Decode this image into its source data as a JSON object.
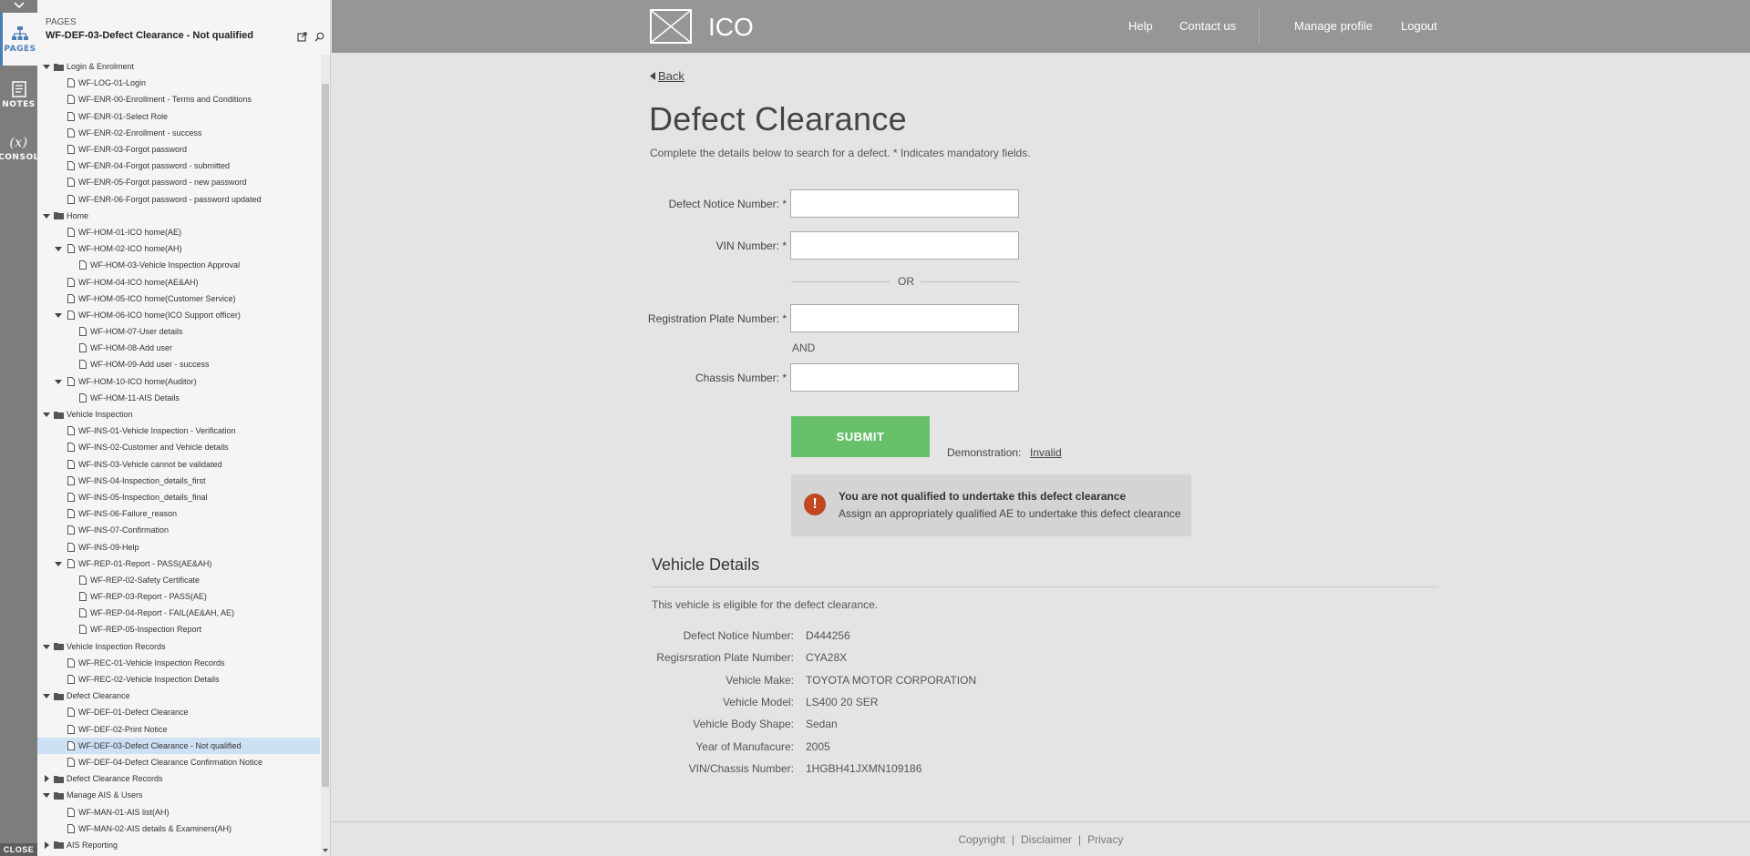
{
  "rail": {
    "pages_label": "PAGES",
    "notes_label": "NOTES",
    "console_label": "CONSOL",
    "console_symbol": "(x)",
    "close_label": "CLOSE"
  },
  "panel": {
    "caption": "PAGES",
    "current_page": "WF-DEF-03-Defect Clearance - Not qualified",
    "tree": [
      {
        "label": "Login & Enrolment",
        "type": "folder",
        "level": 0,
        "expanded": true
      },
      {
        "label": "WF-LOG-01-Login",
        "type": "page",
        "level": 1
      },
      {
        "label": "WF-ENR-00-Enrollment - Terms and Conditions",
        "type": "page",
        "level": 1
      },
      {
        "label": "WF-ENR-01-Select Role",
        "type": "page",
        "level": 1
      },
      {
        "label": "WF-ENR-02-Enrollment - success",
        "type": "page",
        "level": 1
      },
      {
        "label": "WF-ENR-03-Forgot password",
        "type": "page",
        "level": 1
      },
      {
        "label": "WF-ENR-04-Forgot password - submitted",
        "type": "page",
        "level": 1
      },
      {
        "label": "WF-ENR-05-Forgot password - new password",
        "type": "page",
        "level": 1
      },
      {
        "label": "WF-ENR-06-Forgot password - password updated",
        "type": "page",
        "level": 1
      },
      {
        "label": "Home",
        "type": "folder",
        "level": 0,
        "expanded": true
      },
      {
        "label": "WF-HOM-01-ICO home(AE)",
        "type": "page",
        "level": 1
      },
      {
        "label": "WF-HOM-02-ICO home(AH)",
        "type": "page",
        "level": 1,
        "expanded": true
      },
      {
        "label": "WF-HOM-03-Vehicle Inspection Approval",
        "type": "page",
        "level": 2
      },
      {
        "label": "WF-HOM-04-ICO home(AE&AH)",
        "type": "page",
        "level": 1
      },
      {
        "label": "WF-HOM-05-ICO home(Customer Service)",
        "type": "page",
        "level": 1
      },
      {
        "label": "WF-HOM-06-ICO home(ICO Support officer)",
        "type": "page",
        "level": 1,
        "expanded": true
      },
      {
        "label": "WF-HOM-07-User details",
        "type": "page",
        "level": 2
      },
      {
        "label": "WF-HOM-08-Add user",
        "type": "page",
        "level": 2
      },
      {
        "label": "WF-HOM-09-Add user - success",
        "type": "page",
        "level": 2
      },
      {
        "label": "WF-HOM-10-ICO home(Auditor)",
        "type": "page",
        "level": 1,
        "expanded": true
      },
      {
        "label": "WF-HOM-11-AIS Details",
        "type": "page",
        "level": 2
      },
      {
        "label": "Vehicle Inspection",
        "type": "folder",
        "level": 0,
        "expanded": true
      },
      {
        "label": "WF-INS-01-Vehicle Inspection - Verification",
        "type": "page",
        "level": 1
      },
      {
        "label": "WF-INS-02-Customer and Vehicle details",
        "type": "page",
        "level": 1
      },
      {
        "label": "WF-INS-03-Vehicle cannot be validated",
        "type": "page",
        "level": 1
      },
      {
        "label": "WF-INS-04-Inspection_details_first",
        "type": "page",
        "level": 1
      },
      {
        "label": "WF-INS-05-Inspection_details_final",
        "type": "page",
        "level": 1
      },
      {
        "label": "WF-INS-06-Failure_reason",
        "type": "page",
        "level": 1
      },
      {
        "label": "WF-INS-07-Confirmation",
        "type": "page",
        "level": 1
      },
      {
        "label": "WF-INS-09-Help",
        "type": "page",
        "level": 1
      },
      {
        "label": "WF-REP-01-Report - PASS(AE&AH)",
        "type": "page",
        "level": 1,
        "expanded": true
      },
      {
        "label": "WF-REP-02-Safety Certificate",
        "type": "page",
        "level": 2
      },
      {
        "label": "WF-REP-03-Report - PASS(AE)",
        "type": "page",
        "level": 2
      },
      {
        "label": "WF-REP-04-Report - FAIL(AE&AH, AE)",
        "type": "page",
        "level": 2
      },
      {
        "label": "WF-REP-05-Inspection Report",
        "type": "page",
        "level": 2
      },
      {
        "label": "Vehicle Inspection Records",
        "type": "folder",
        "level": 0,
        "expanded": true
      },
      {
        "label": "WF-REC-01-Vehicle Inspection Records",
        "type": "page",
        "level": 1
      },
      {
        "label": "WF-REC-02-Vehicle Inspection Details",
        "type": "page",
        "level": 1
      },
      {
        "label": "Defect Clearance",
        "type": "folder",
        "level": 0,
        "expanded": true
      },
      {
        "label": "WF-DEF-01-Defect Clearance",
        "type": "page",
        "level": 1
      },
      {
        "label": "WF-DEF-02-Print Notice",
        "type": "page",
        "level": 1
      },
      {
        "label": "WF-DEF-03-Defect Clearance - Not qualified",
        "type": "page",
        "level": 1,
        "selected": true
      },
      {
        "label": "WF-DEF-04-Defect Clearance Confirmation Notice",
        "type": "page",
        "level": 1
      },
      {
        "label": "Defect Clearance Records",
        "type": "folder",
        "level": 0,
        "expanded": false
      },
      {
        "label": "Manage AIS & Users",
        "type": "folder",
        "level": 0,
        "expanded": true
      },
      {
        "label": "WF-MAN-01-AIS list(AH)",
        "type": "page",
        "level": 1
      },
      {
        "label": "WF-MAN-02-AIS details & Examiners(AH)",
        "type": "page",
        "level": 1
      },
      {
        "label": "AIS Reporting",
        "type": "folder",
        "level": 0,
        "expanded": false
      }
    ]
  },
  "header": {
    "logo_text": "ICO",
    "nav": {
      "help": "Help",
      "contact": "Contact us",
      "manage_profile": "Manage profile",
      "logout": "Logout"
    }
  },
  "page": {
    "back": "Back",
    "title": "Defect Clearance",
    "intro": "Complete the details below to search for a defect.  * Indicates mandatory fields."
  },
  "form": {
    "defect_notice_label": "Defect Notice Number: *",
    "defect_notice_value": "",
    "vin_label": "VIN Number: *",
    "vin_value": "",
    "or_text": "OR",
    "rego_label": "Registration Plate Number: *",
    "rego_value": "",
    "and_text": "AND",
    "chassis_label": "Chassis Number: *",
    "chassis_value": "",
    "submit": "SUBMIT",
    "demo_label": "Demonstration:",
    "demo_link": "Invalid"
  },
  "alert": {
    "icon": "!",
    "title": "You are not qualified to undertake this defect clearance",
    "body": "Assign an appropriately qualified AE to undertake this defect clearance",
    "color": "#c0471f"
  },
  "vehicle": {
    "title": "Vehicle Details",
    "eligibility": "This vehicle is eligible for the defect clearance.",
    "rows": [
      {
        "label": "Defect Notice Number:",
        "value": "D444256"
      },
      {
        "label": "Regisrsration Plate Number:",
        "value": "CYA28X"
      },
      {
        "label": "Vehicle Make:",
        "value": "TOYOTA MOTOR CORPORATION"
      },
      {
        "label": "Vehicle Model:",
        "value": "LS400 20 SER"
      },
      {
        "label": "Vehicle Body Shape:",
        "value": "Sedan"
      },
      {
        "label": "Year of Manufacure:",
        "value": "2005"
      },
      {
        "label": "VIN/Chassis Number:",
        "value": "1HGBH41JXMN109186"
      }
    ]
  },
  "footer": {
    "copyright": "Copyright",
    "disclaimer": "Disclaimer",
    "privacy": "Privacy",
    "separator": "|"
  },
  "colors": {
    "submit": "#68c06a",
    "header": "#969696",
    "selected_row": "#cde0f4",
    "rail": "#7d7d7d"
  }
}
